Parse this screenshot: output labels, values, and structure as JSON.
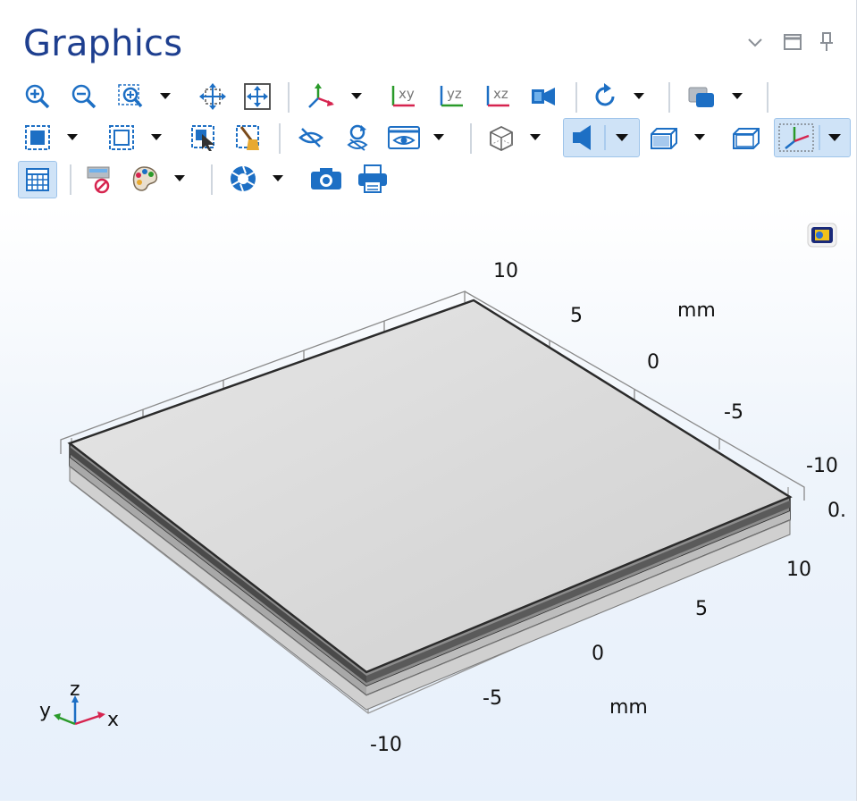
{
  "window": {
    "title": "Graphics",
    "controls": [
      "chevron-down-icon",
      "maximize-icon",
      "pin-icon"
    ]
  },
  "toolbar": {
    "row1": [
      "zoom-in",
      "zoom-out",
      "zoom-box",
      "zoom-extents-selection",
      "zoom-extents",
      "go-to-default-view",
      "xy-view",
      "yz-view",
      "xz-view",
      "camera-view",
      "rotate-view",
      "transparency"
    ],
    "row2": [
      "select-box",
      "deselect-box",
      "select-all",
      "clear-selection",
      "hide",
      "reset-hiding",
      "view-options",
      "wireframe-rendering",
      "lighting",
      "render-mode",
      "scene-box",
      "coordinate-system"
    ],
    "row3": [
      "grid",
      "clear-plots",
      "color-table",
      "image-snapshot",
      "camera-snapshot",
      "print"
    ],
    "view_options_label": "xy",
    "yz_label": "yz",
    "xz_label": "xz"
  },
  "plot": {
    "x_axis": {
      "unit": "mm",
      "ticks": [
        "-10",
        "-5",
        "0",
        "5",
        "10"
      ]
    },
    "y_axis": {
      "unit": "mm",
      "ticks": [
        "-10",
        "-5",
        "0",
        "5",
        "10"
      ]
    },
    "z_axis": {
      "ticks": [
        "0."
      ]
    },
    "triad": {
      "x": "x",
      "y": "y",
      "z": "z"
    },
    "colors": {
      "plate_top": "#dcdcdc",
      "plate_edge": "#2b2b2b",
      "grid": "#9a9a9a"
    }
  }
}
